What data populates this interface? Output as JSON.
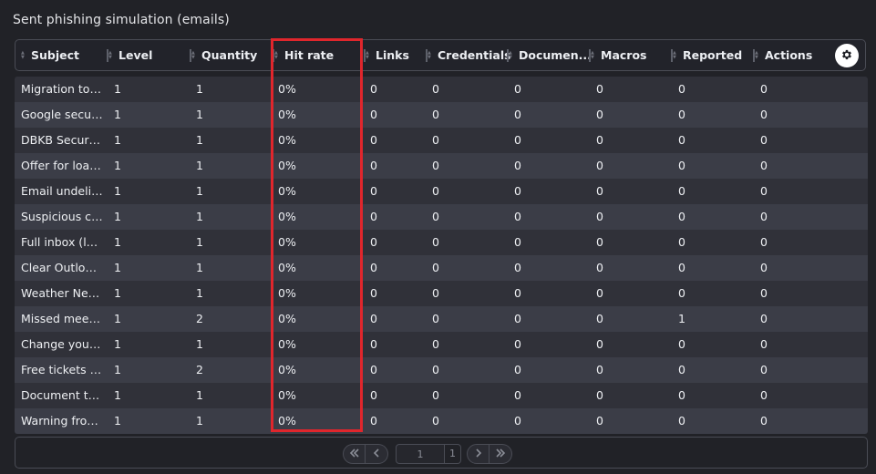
{
  "title": "Sent phishing simulation (emails)",
  "columns": [
    {
      "key": "subject",
      "label": "Subject"
    },
    {
      "key": "level",
      "label": "Level"
    },
    {
      "key": "quantity",
      "label": "Quantity"
    },
    {
      "key": "hit_rate",
      "label": "Hit rate"
    },
    {
      "key": "links",
      "label": "Links"
    },
    {
      "key": "credentials",
      "label": "Credentials"
    },
    {
      "key": "documents",
      "label": "Documen..."
    },
    {
      "key": "macros",
      "label": "Macros"
    },
    {
      "key": "reported",
      "label": "Reported"
    },
    {
      "key": "actions",
      "label": "Actions"
    }
  ],
  "settings_icon": "gear-icon",
  "rows": [
    [
      "Migration to ...",
      "1",
      "1",
      "0%",
      "0",
      "0",
      "0",
      "0",
      "0",
      "0"
    ],
    [
      "Google securi...",
      "1",
      "1",
      "0%",
      "0",
      "0",
      "0",
      "0",
      "0",
      "0"
    ],
    [
      "DBKB Securit...",
      "1",
      "1",
      "0%",
      "0",
      "0",
      "0",
      "0",
      "0",
      "0"
    ],
    [
      "Offer for loan...",
      "1",
      "1",
      "0%",
      "0",
      "0",
      "0",
      "0",
      "0",
      "0"
    ],
    [
      "Email undeliv...",
      "1",
      "1",
      "0%",
      "0",
      "0",
      "0",
      "0",
      "0",
      "0"
    ],
    [
      "Suspicious cr...",
      "1",
      "1",
      "0%",
      "0",
      "0",
      "0",
      "0",
      "0",
      "0"
    ],
    [
      "Full inbox (le...",
      "1",
      "1",
      "0%",
      "0",
      "0",
      "0",
      "0",
      "0",
      "0"
    ],
    [
      "Clear Outlook...",
      "1",
      "1",
      "0%",
      "0",
      "0",
      "0",
      "0",
      "0",
      "0"
    ],
    [
      "Weather New...",
      "1",
      "1",
      "0%",
      "0",
      "0",
      "0",
      "0",
      "0",
      "0"
    ],
    [
      "Missed meeti...",
      "1",
      "2",
      "0%",
      "0",
      "0",
      "0",
      "0",
      "1",
      "0"
    ],
    [
      "Change your ...",
      "1",
      "1",
      "0%",
      "0",
      "0",
      "0",
      "0",
      "0",
      "0"
    ],
    [
      "Free tickets f...",
      "1",
      "2",
      "0%",
      "0",
      "0",
      "0",
      "0",
      "0",
      "0"
    ],
    [
      "Document to ...",
      "1",
      "1",
      "0%",
      "0",
      "0",
      "0",
      "0",
      "0",
      "0"
    ],
    [
      "Warning from...",
      "1",
      "1",
      "0%",
      "0",
      "0",
      "0",
      "0",
      "0",
      "0"
    ]
  ],
  "pagination": {
    "current_page": "1",
    "total_pages": "1",
    "first_icon": "double-chevron-left-icon",
    "prev_icon": "chevron-left-icon",
    "next_icon": "chevron-right-icon",
    "last_icon": "double-chevron-right-icon"
  },
  "colors": {
    "highlight": "#e0262c",
    "row_odd": "#303139",
    "row_even": "#3b3d47"
  }
}
